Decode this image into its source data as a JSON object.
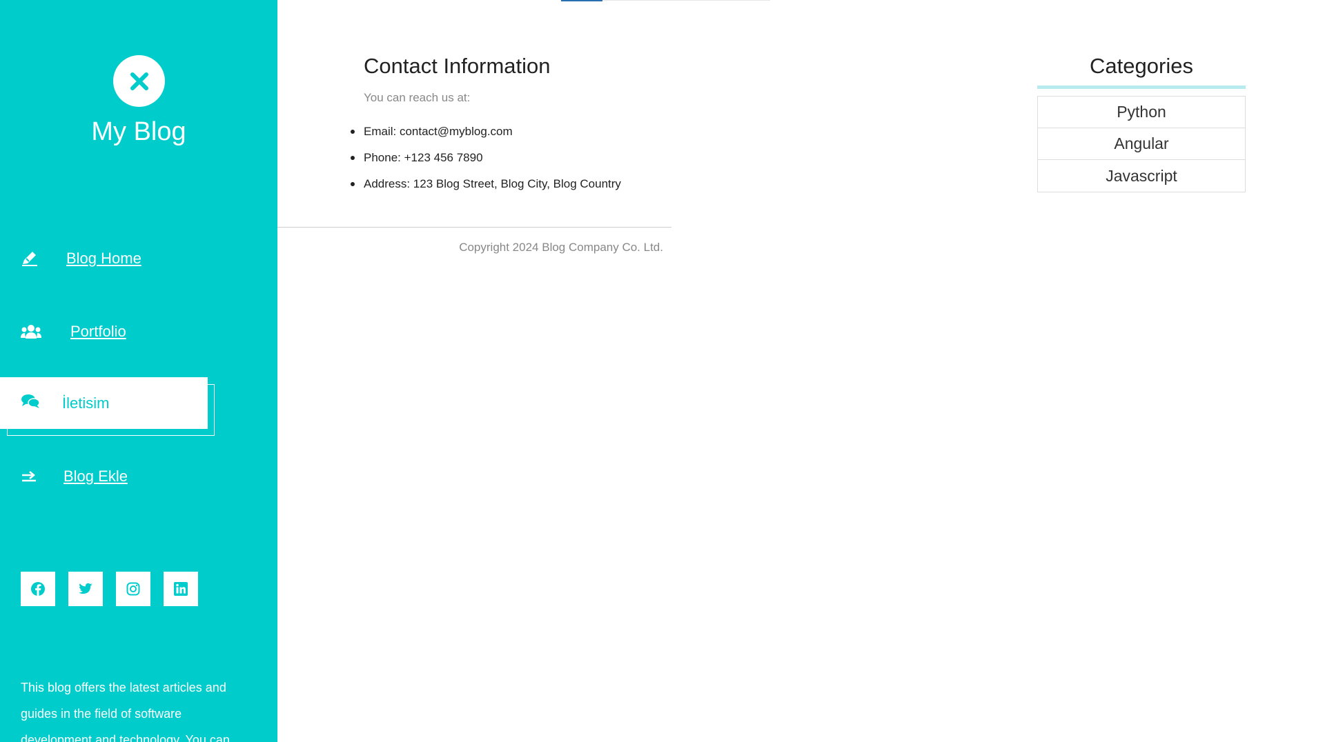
{
  "colors": {
    "sidebar_bg": "#00cccc",
    "text_dark": "#222222",
    "text_muted": "#888888",
    "category_underline": "#b8ebef"
  },
  "sidebar": {
    "close_icon": "close-x-icon",
    "brand": "My Blog",
    "nav": [
      {
        "label": "Blog Home",
        "icon": "pen-icon",
        "active": false
      },
      {
        "label": "Portfolio",
        "icon": "users-icon",
        "active": false
      },
      {
        "label": "İletisim",
        "icon": "comments-icon",
        "active": true
      },
      {
        "label": "Blog Ekle",
        "icon": "arrow-right-icon",
        "active": false
      }
    ],
    "socials": [
      {
        "icon": "facebook-icon"
      },
      {
        "icon": "twitter-icon"
      },
      {
        "icon": "instagram-icon"
      },
      {
        "icon": "linkedin-icon"
      }
    ],
    "about": "This blog offers the latest articles and guides in the field of software development and technology. You can"
  },
  "contact": {
    "title": "Contact Information",
    "subtitle": "You can reach us at:",
    "items": [
      "Email: contact@myblog.com",
      "Phone: +123 456 7890",
      "Address: 123 Blog Street, Blog City, Blog Country"
    ]
  },
  "footer": {
    "copyright": "Copyright 2024 Blog Company Co. Ltd."
  },
  "categories": {
    "title": "Categories",
    "items": [
      "Python",
      "Angular",
      "Javascript"
    ]
  }
}
